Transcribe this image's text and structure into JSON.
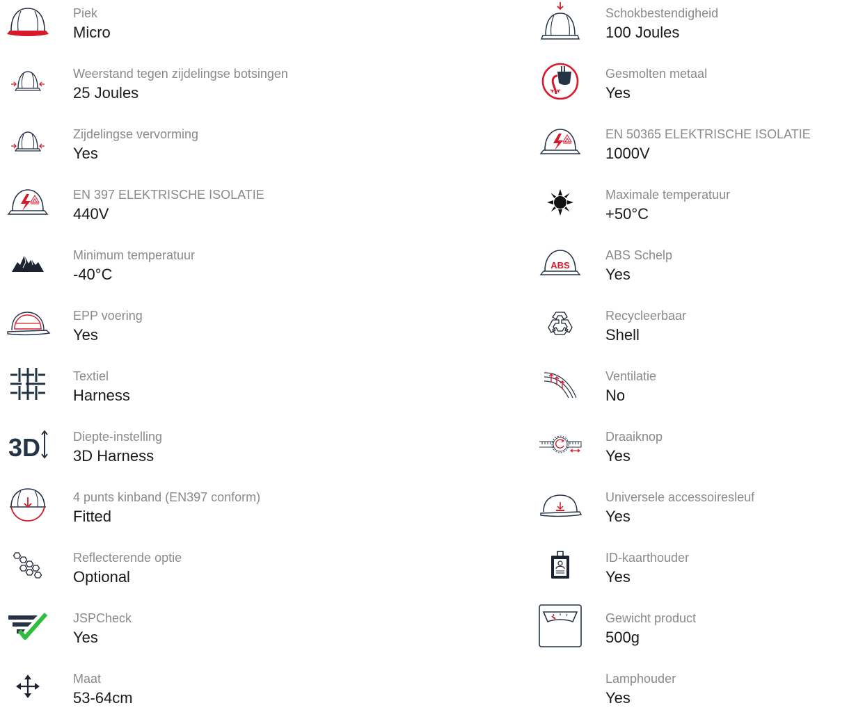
{
  "colors": {
    "red": "#d7192b",
    "navy": "#253346",
    "green": "#2ebd3e",
    "label_gray": "#8a8a8a",
    "value_dark": "#1a1a1a"
  },
  "left": [
    {
      "icon": "helmet-peak-icon",
      "label": "Piek",
      "value": "Micro"
    },
    {
      "icon": "side-impact-icon",
      "label": "Weerstand tegen zijdelingse botsingen",
      "value": "25 Joules"
    },
    {
      "icon": "lateral-deformation-icon",
      "label": "Zijdelingse vervorming",
      "value": "Yes"
    },
    {
      "icon": "electrical-insulation-icon",
      "label": "EN 397 ELEKTRISCHE ISOLATIE",
      "value": "440V"
    },
    {
      "icon": "mountains-icon",
      "label": "Minimum temperatuur",
      "value": "-40°C"
    },
    {
      "icon": "epp-liner-icon",
      "label": "EPP voering",
      "value": "Yes"
    },
    {
      "icon": "textile-grid-icon",
      "label": "Textiel",
      "value": "Harness"
    },
    {
      "icon": "3d-depth-icon",
      "label": "Diepte-instelling",
      "value": "3D Harness"
    },
    {
      "icon": "chinstrap-icon",
      "label": "4 punts kinband (EN397 conform)",
      "value": "Fitted"
    },
    {
      "icon": "reflective-hexagons-icon",
      "label": "Reflecterende optie",
      "value": "Optional"
    },
    {
      "icon": "jspcheck-icon",
      "label": "JSPCheck",
      "value": "Yes"
    },
    {
      "icon": "move-arrows-icon",
      "label": "Maat",
      "value": "53-64cm"
    }
  ],
  "right": [
    {
      "icon": "shock-absorption-icon",
      "label": "Schokbestendigheid",
      "value": "100 Joules"
    },
    {
      "icon": "molten-metal-icon",
      "label": "Gesmolten metaal",
      "value": "Yes"
    },
    {
      "icon": "electrical-insulation-icon",
      "label": "EN 50365 ELEKTRISCHE ISOLATIE",
      "value": "1000V"
    },
    {
      "icon": "sun-icon",
      "label": "Maximale temperatuur",
      "value": "+50°C"
    },
    {
      "icon": "abs-shell-icon",
      "label": "ABS Schelp",
      "value": "Yes",
      "icon_text": "ABS"
    },
    {
      "icon": "recycle-icon",
      "label": "Recycleerbaar",
      "value": "Shell"
    },
    {
      "icon": "ventilation-icon",
      "label": "Ventilatie",
      "value": "No"
    },
    {
      "icon": "ratchet-knob-icon",
      "label": "Draaiknop",
      "value": "Yes"
    },
    {
      "icon": "accessory-slot-icon",
      "label": "Universele accessoiresleuf",
      "value": "Yes"
    },
    {
      "icon": "id-card-holder-icon",
      "label": "ID-kaarthouder",
      "value": "Yes"
    },
    {
      "icon": "weighing-scale-icon",
      "label": "Gewicht product",
      "value": "500g"
    },
    {
      "icon": "lamp-holder-icon",
      "label": "Lamphouder",
      "value": "Yes"
    }
  ]
}
